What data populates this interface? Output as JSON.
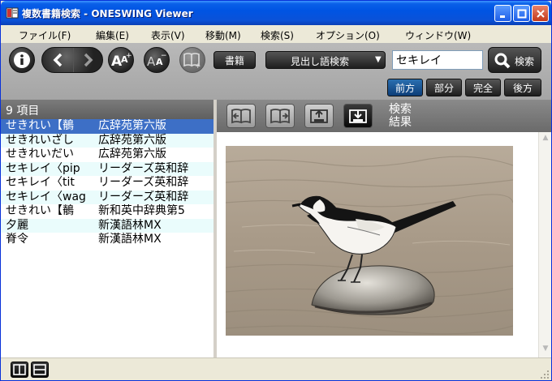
{
  "window": {
    "title": "複数書籍検索 - ONESWING Viewer",
    "minimize_icon": "minimize-icon",
    "maximize_icon": "maximize-icon",
    "close_icon": "close-icon"
  },
  "menu": [
    {
      "label": "ファイル(F)"
    },
    {
      "label": "編集(E)"
    },
    {
      "label": "表示(V)"
    },
    {
      "label": "移動(M)"
    },
    {
      "label": "検索(S)"
    },
    {
      "label": "オプション(O)"
    },
    {
      "label": "ウィンドウ(W)"
    }
  ],
  "toolbar": {
    "info_icon": "info-icon",
    "back_icon": "chevron-left-icon",
    "forward_icon": "chevron-right-icon",
    "font_larger_icon": "font-increase-icon",
    "font_smaller_icon": "font-decrease-icon",
    "bookmark_add_icon": "book-add-icon",
    "books_label": "書籍",
    "search_type": "見出し語検索",
    "search_query": "セキレイ",
    "search_button": "検索",
    "match_modes": [
      {
        "label": "前方",
        "active": true
      },
      {
        "label": "部分",
        "active": false
      },
      {
        "label": "完全",
        "active": false
      },
      {
        "label": "後方",
        "active": false
      }
    ]
  },
  "results": {
    "count_label": "9 項目",
    "items": [
      {
        "headword": "せきれい【鶺",
        "dictionary": "広辞苑第六版",
        "selected": true
      },
      {
        "headword": "せきれいざし",
        "dictionary": "広辞苑第六版",
        "selected": false
      },
      {
        "headword": "せきれいだい",
        "dictionary": "広辞苑第六版",
        "selected": false
      },
      {
        "headword": "セキレイ〈pip",
        "dictionary": "リーダーズ英和辞",
        "selected": false
      },
      {
        "headword": "セキレイ〈tit",
        "dictionary": "リーダーズ英和辞",
        "selected": false
      },
      {
        "headword": "セキレイ〈wag",
        "dictionary": "リーダーズ英和辞",
        "selected": false
      },
      {
        "headword": "せきれい【鶺",
        "dictionary": "新和英中辞典第5",
        "selected": false
      },
      {
        "headword": "夕麗",
        "dictionary": "新漢語林MX",
        "selected": false
      },
      {
        "headword": "脊令",
        "dictionary": "新漢語林MX",
        "selected": false
      }
    ]
  },
  "viewer": {
    "result_label": "検索結果",
    "buttons": [
      "prev-entry-icon",
      "next-entry-icon",
      "export-icon",
      "import-icon"
    ],
    "image_subject": "wagtail-bird-on-rock-photo"
  },
  "colors": {
    "titlebar": "#0054e3",
    "toolbar": "#a8a8a8",
    "selection": "#3d6fc6",
    "alt_row": "#eafcfc",
    "active_mode": "#1f5a96"
  }
}
